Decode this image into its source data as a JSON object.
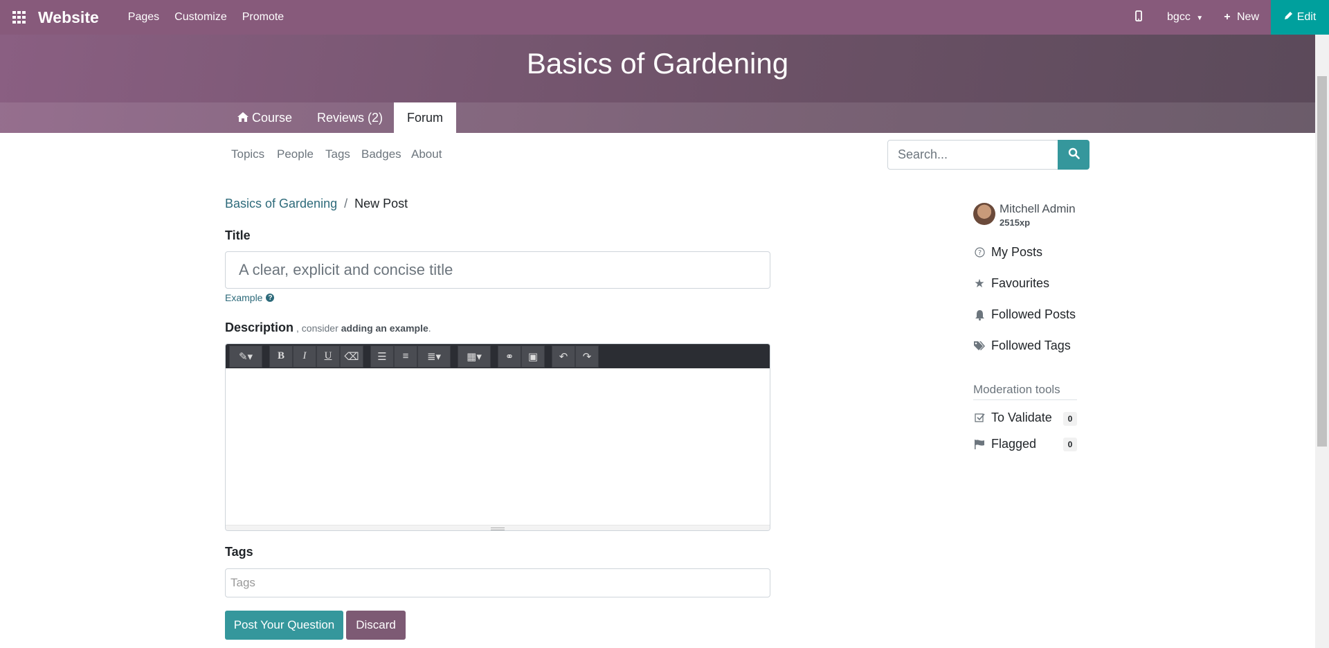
{
  "topbar": {
    "brand": "Website",
    "menu": [
      "Pages",
      "Customize",
      "Promote"
    ],
    "website_switcher": "bgcc",
    "new_label": "New",
    "edit_label": "Edit"
  },
  "banner": {
    "title": "Basics of Gardening",
    "tabs": [
      "Course",
      "Reviews (2)",
      "Forum"
    ]
  },
  "subnav": {
    "items": [
      "Topics",
      "People",
      "Tags",
      "Badges",
      "About"
    ],
    "search_placeholder": "Search..."
  },
  "breadcrumb": {
    "parent": "Basics of Gardening",
    "separator": "/",
    "current": "New Post"
  },
  "form": {
    "title_label": "Title",
    "title_placeholder": "A clear, explicit and concise title",
    "example_link": "Example",
    "description_label": "Description",
    "description_hint_prefix": ", consider",
    "description_hint_bold": "adding an example",
    "description_hint_suffix": ".",
    "tags_label": "Tags",
    "tags_placeholder": "Tags",
    "submit_label": "Post Your Question",
    "discard_label": "Discard"
  },
  "sidebar": {
    "user_name": "Mitchell Admin",
    "user_xp": "2515xp",
    "links": [
      "My Posts",
      "Favourites",
      "Followed Posts",
      "Followed Tags"
    ],
    "moderation_title": "Moderation tools",
    "to_validate_label": "To Validate",
    "to_validate_count": "0",
    "flagged_label": "Flagged",
    "flagged_count": "0"
  },
  "colors": {
    "topbar": "#875a7b",
    "edit_button": "#00a09d",
    "primary_button": "#35979c",
    "discard_button": "#7d5a74"
  }
}
